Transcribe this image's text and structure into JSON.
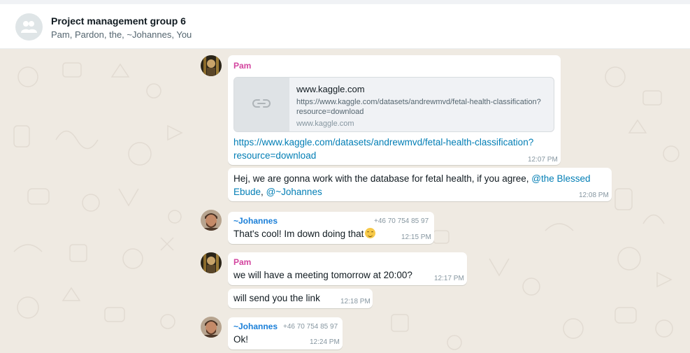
{
  "header": {
    "title": "Project management group 6",
    "participants": "Pam, Pardon, the, ~Johannes, You"
  },
  "messages": [
    {
      "sender": "Pam",
      "preview": {
        "title": "www.kaggle.com",
        "description": "https://www.kaggle.com/datasets/andrewmvd/fetal-health-classification?resource=download",
        "domain": "www.kaggle.com"
      },
      "link_line1": "https://www.kaggle.com/datasets/andrewmvd/fetal-health-classification?",
      "link_line2": "resource=download",
      "time": "12:07 PM"
    },
    {
      "text_line1": "Hej, we are gonna work with the database for fetal health, if you agree, ",
      "mention1": "@the Blessed",
      "mention1_cont": "Ebude",
      "separator": ", ",
      "mention2": "@~Johannes",
      "time": "12:08 PM"
    },
    {
      "sender": "~Johannes",
      "phone": "+46 70 754 85 97",
      "text": "That's cool! Im down doing that",
      "emoji": "relieved-face-emoji",
      "time": "12:15 PM"
    },
    {
      "sender": "Pam",
      "text": "we will have a meeting tomorrow at 20:00?",
      "time": "12:17 PM"
    },
    {
      "text": "will send you the link",
      "time": "12:18 PM"
    },
    {
      "sender": "~Johannes",
      "phone": "+46 70 754 85 97",
      "text": "Ok!",
      "time": "12:24 PM"
    }
  ],
  "icons": {
    "group_avatar": "group-icon",
    "preview_thumb": "link-icon"
  },
  "colors": {
    "chat_background": "#efeae2",
    "bubble": "#ffffff",
    "pam_name": "#d3459f",
    "johannes_name": "#1a7fd8",
    "link": "#027eb5"
  }
}
